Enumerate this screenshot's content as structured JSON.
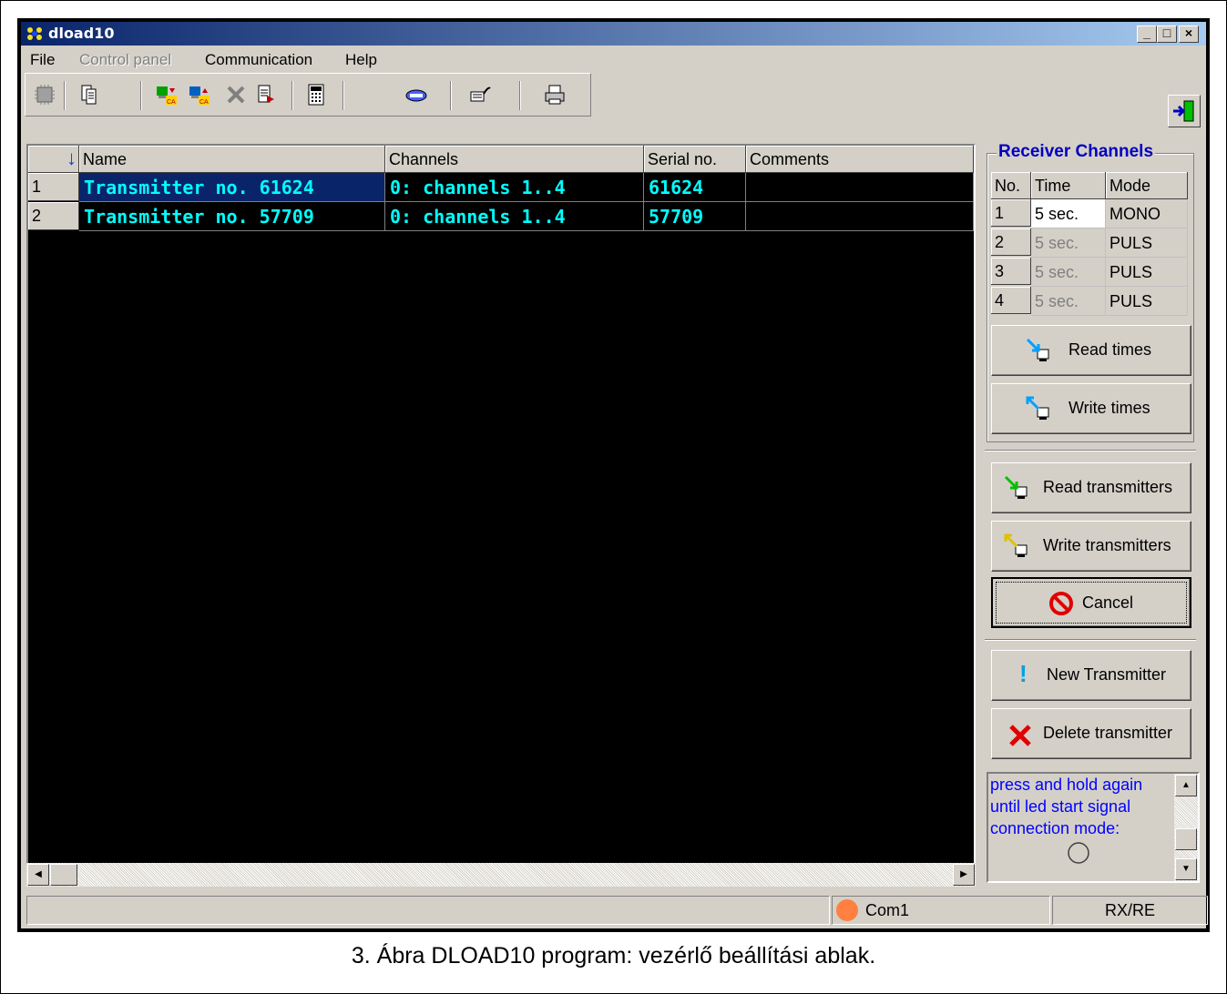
{
  "window": {
    "title": "dload10",
    "buttons": [
      "_",
      "□",
      "×"
    ]
  },
  "menu": [
    {
      "label": "File",
      "disabled": false
    },
    {
      "label": "Control panel",
      "disabled": true
    },
    {
      "label": "Communication",
      "disabled": false
    },
    {
      "label": "Help",
      "disabled": false
    }
  ],
  "grid": {
    "sort_indicator": "↓",
    "columns": [
      "Name",
      "Channels",
      "Serial no.",
      "Comments"
    ],
    "rows": [
      {
        "no": "1",
        "name": "Transmitter no. 61624",
        "channels": "0: channels 1..4",
        "serial": "61624",
        "comments": ""
      },
      {
        "no": "2",
        "name": "Transmitter no. 57709",
        "channels": "0: channels 1..4",
        "serial": "57709",
        "comments": ""
      }
    ]
  },
  "receiver": {
    "title": "Receiver Channels",
    "columns": [
      "No.",
      "Time",
      "Mode"
    ],
    "rows": [
      {
        "no": "1",
        "time": "5 sec.",
        "mode": "MONO"
      },
      {
        "no": "2",
        "time": "5 sec.",
        "mode": "PULS"
      },
      {
        "no": "3",
        "time": "5 sec.",
        "mode": "PULS"
      },
      {
        "no": "4",
        "time": "5 sec.",
        "mode": "PULS"
      }
    ]
  },
  "buttons": {
    "read_times": "Read times",
    "write_times": "Write times",
    "read_transmitters": "Read transmitters",
    "write_transmitters": "Write transmitters",
    "cancel": "Cancel",
    "new_transmitter": "New Transmitter",
    "delete_transmitter": "Delete transmitter"
  },
  "message": {
    "line1": "press and hold again",
    "line2": "until led start signal",
    "line3": "connection mode:"
  },
  "status": {
    "port": "Com1",
    "mode": "RX/RE"
  },
  "caption": "3. Ábra DLOAD10 program: vezérlő beállítási ablak.",
  "colors": {
    "selection": "#0a246a",
    "grid_text": "#00ffff",
    "group_title": "#0000c0",
    "message_text": "#0000ff",
    "status_led": "#ff8040"
  }
}
